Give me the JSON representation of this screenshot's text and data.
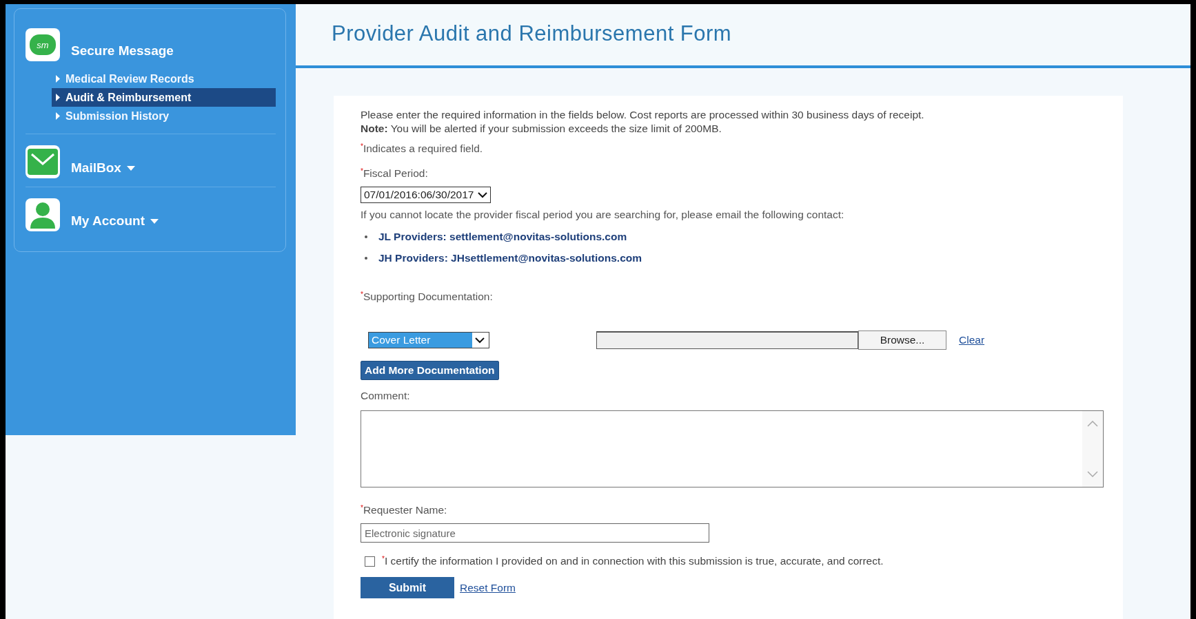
{
  "sidebar": {
    "sections": [
      {
        "kind": "secure",
        "icon_text": "sm",
        "title": "Secure Message",
        "items": [
          {
            "label": "Medical Review Records",
            "selected": false
          },
          {
            "label": "Audit & Reimbursement",
            "selected": true
          },
          {
            "label": "Submission History",
            "selected": false
          }
        ]
      },
      {
        "kind": "mail",
        "title": "MailBox"
      },
      {
        "kind": "account",
        "title": "My Account"
      }
    ]
  },
  "page_title": "Provider Audit and Reimbursement Form",
  "form": {
    "intro": "Please enter the required information in the fields below. Cost reports are processed within 30 business days of receipt.",
    "note": "**Note:** You will be alerted if your submission exceeds the size limit of 200MB.",
    "required_legend": {
      "mark": "*",
      "text": "Indicates a required field."
    },
    "fiscal_period": {
      "mark": "*",
      "label": "Fiscal Period:",
      "value": "07/01/2016:06/30/2017"
    },
    "contact_help": "If you cannot locate the provider fiscal period you are searching for, please email the following contact:",
    "contacts": [
      "JL Providers: settlement@novitas-solutions.com",
      "JH Providers: JHsettlement@novitas-solutions.com"
    ],
    "documentation": {
      "mark": "*",
      "label": "Supporting Documentation:",
      "type_value": "Cover Letter",
      "browse": "Browse...",
      "clear": "Clear",
      "add_more": "Add More Documentation"
    },
    "comment": {
      "label": "Comment:"
    },
    "requester": {
      "mark": "*",
      "label": "Requester Name:",
      "placeholder": "Electronic signature"
    },
    "certify": {
      "checked": false,
      "mark": "*",
      "text": "I certify the information I provided on and in connection with this submission is true, accurate, and correct."
    },
    "buttons": {
      "submit": "Submit",
      "reset": "Reset Form"
    }
  }
}
